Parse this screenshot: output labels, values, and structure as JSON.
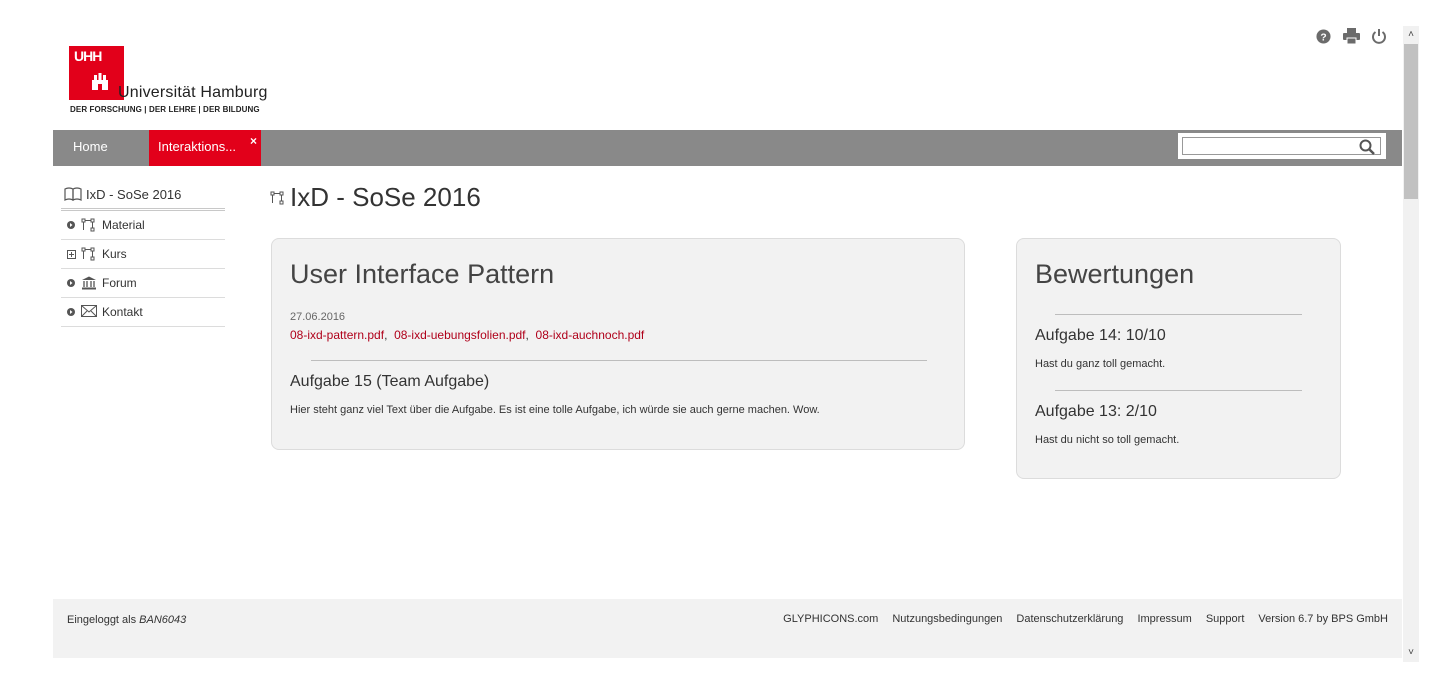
{
  "header": {
    "logo_mark": "UHH",
    "logo_name": "Universität Hamburg",
    "logo_subline": "DER FORSCHUNG | DER LEHRE | DER BILDUNG",
    "icons": [
      "help-icon",
      "print-icon",
      "power-icon"
    ]
  },
  "nav": {
    "home": "Home",
    "active_tab": "Interaktions...",
    "close": "×",
    "search_value": "",
    "search_placeholder": ""
  },
  "sidebar": {
    "title": "IxD - SoSe 2016",
    "items": [
      {
        "label": "Material",
        "toggle": "circle-arrow",
        "icon": "node-icon"
      },
      {
        "label": "Kurs",
        "toggle": "plus-square",
        "icon": "node-icon"
      },
      {
        "label": "Forum",
        "toggle": "circle-arrow",
        "icon": "institution-icon"
      },
      {
        "label": "Kontakt",
        "toggle": "circle-arrow",
        "icon": "envelope-icon"
      }
    ]
  },
  "main": {
    "title": "IxD - SoSe 2016",
    "card": {
      "heading": "User Interface Pattern",
      "date": "27.06.2016",
      "files": [
        "08-ixd-pattern.pdf",
        "08-ixd-uebungsfolien.pdf",
        "08-ixd-auchnoch.pdf"
      ],
      "task_title": "Aufgabe 15 (Team Aufgabe)",
      "task_text": "Hier steht ganz viel Text über die Aufgabe. Es ist eine tolle Aufgabe, ich würde sie auch gerne machen. Wow."
    },
    "ratings": {
      "heading": "Bewertungen",
      "items": [
        {
          "title": "Aufgabe 14: 10/10",
          "text": "Hast du ganz toll gemacht."
        },
        {
          "title": "Aufgabe 13: 2/10",
          "text": "Hast du nicht so toll gemacht."
        }
      ]
    }
  },
  "footer": {
    "logged_in_prefix": "Eingeloggt als",
    "user": "BAN6043",
    "links": [
      "GLYPHICONS.com",
      "Nutzungsbedingungen",
      "Datenschutzerklärung",
      "Impressum",
      "Support",
      "Version 6.7 by BPS GmbH"
    ]
  },
  "colors": {
    "brand": "#e2001a",
    "nav": "#898989",
    "link": "#b0001a",
    "card": "#f2f2f2"
  }
}
